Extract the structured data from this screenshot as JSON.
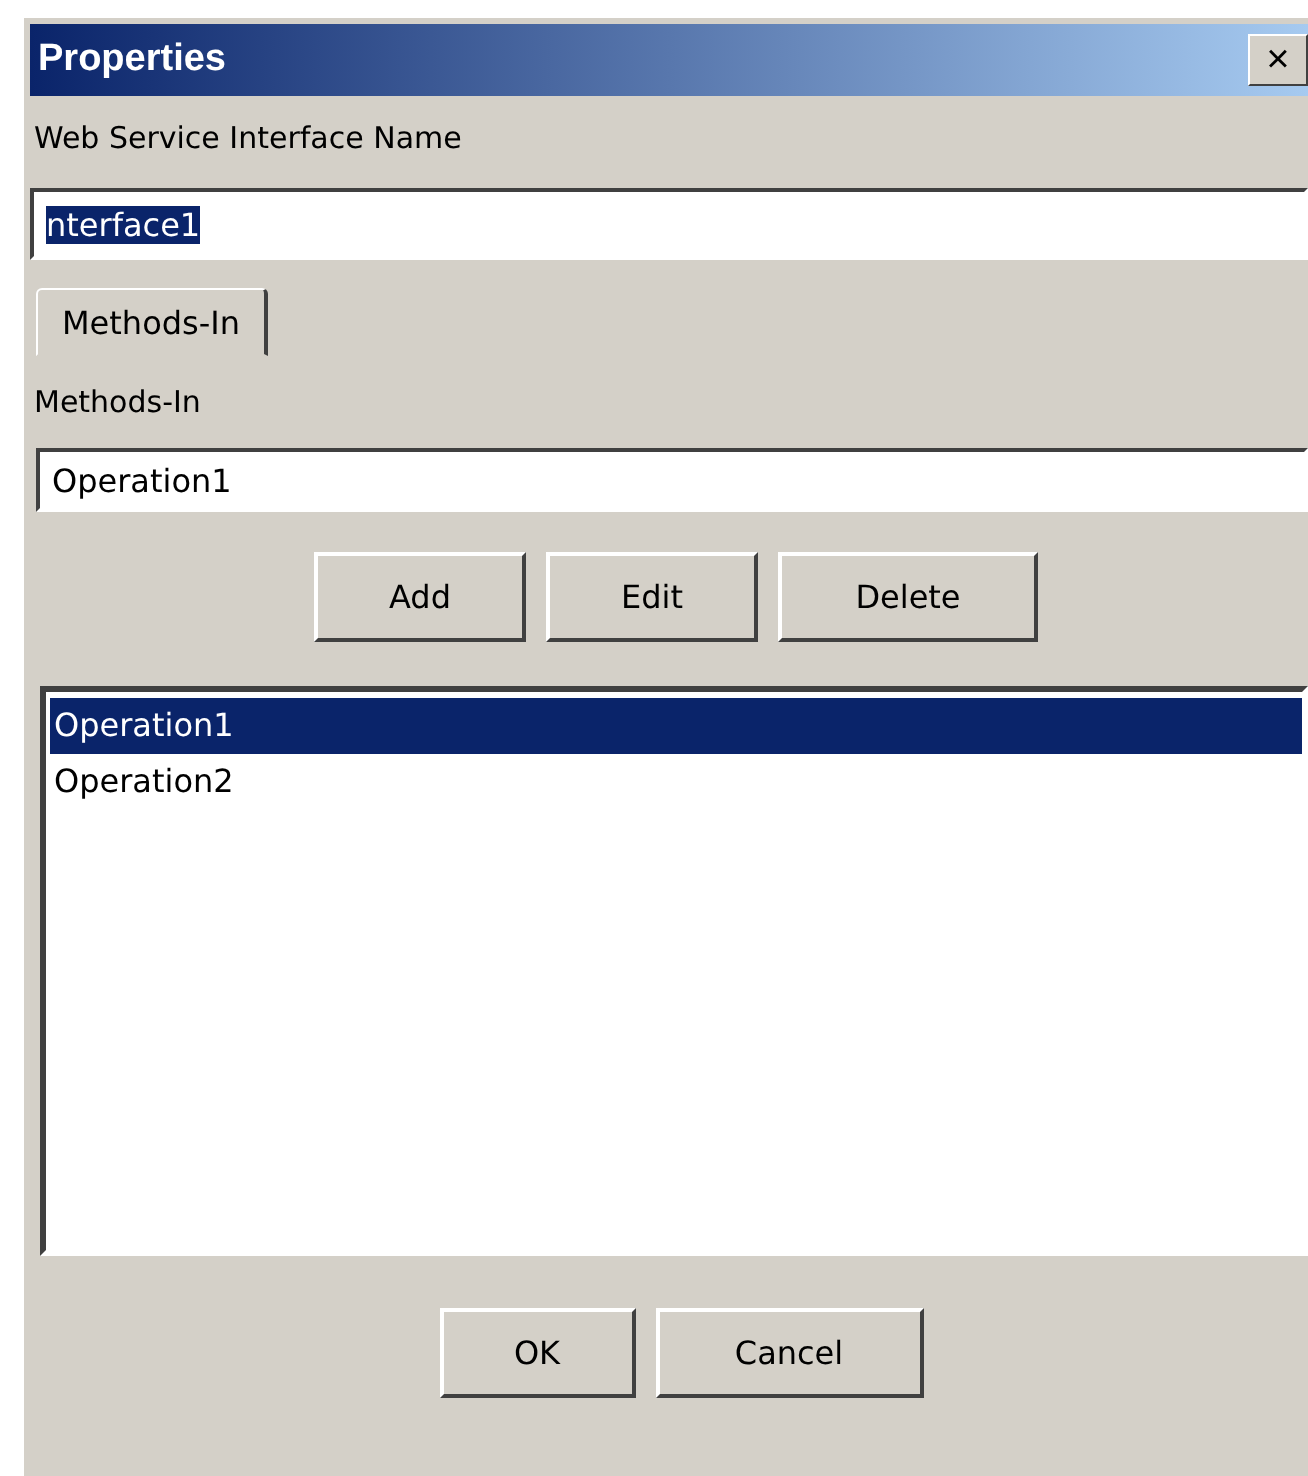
{
  "window": {
    "title": "Properties",
    "close_label": "×"
  },
  "name_label": "Web Service Interface Name",
  "name_field": {
    "value": "nterface1",
    "selected": true
  },
  "tabs": [
    {
      "label": "Methods-In",
      "selected": true
    }
  ],
  "methods_label": "Methods-In",
  "method_field": {
    "value": "Operation1"
  },
  "actions": [
    "Add",
    "Edit",
    "Delete"
  ],
  "methods": [
    {
      "label": "Operation1",
      "selected": true
    },
    {
      "label": "Operation2",
      "selected": false
    }
  ],
  "buttons": [
    "OK",
    "Cancel"
  ]
}
